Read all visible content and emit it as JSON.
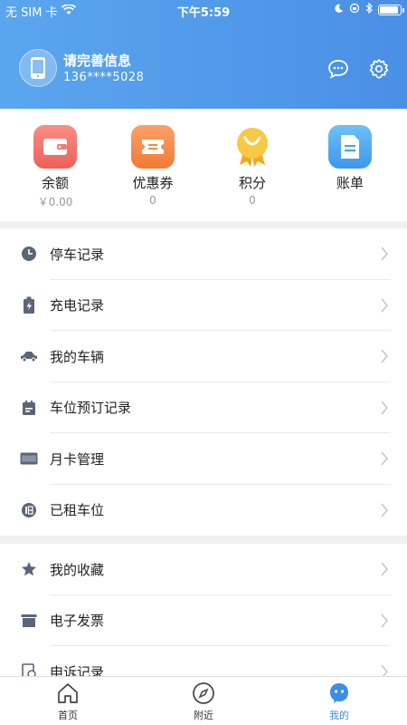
{
  "status_bar": {
    "carrier": "无 SIM 卡",
    "time": "下午5:59"
  },
  "user": {
    "name": "请完善信息",
    "phone": "136****5028"
  },
  "quick": [
    {
      "label": "余额",
      "value": "￥0.00",
      "icon": "wallet-icon",
      "color": "#f0736c"
    },
    {
      "label": "优惠券",
      "value": "0",
      "icon": "ticket-icon",
      "color": "#f58a45"
    },
    {
      "label": "积分",
      "value": "0",
      "icon": "medal-icon",
      "color": "#f6c33a"
    },
    {
      "label": "账单",
      "value": "",
      "icon": "bill-icon",
      "color": "#4aa6f0"
    }
  ],
  "menu_group1": [
    {
      "label": "停车记录",
      "icon": "clock-icon"
    },
    {
      "label": "充电记录",
      "icon": "battery-icon"
    },
    {
      "label": "我的车辆",
      "icon": "car-icon"
    },
    {
      "label": "车位预订记录",
      "icon": "calendar-icon"
    },
    {
      "label": "月卡管理",
      "icon": "card-icon"
    },
    {
      "label": "已租车位",
      "icon": "rent-icon"
    }
  ],
  "menu_group2": [
    {
      "label": "我的收藏",
      "icon": "star-icon"
    },
    {
      "label": "电子发票",
      "icon": "invoice-icon"
    },
    {
      "label": "申诉记录",
      "icon": "appeal-icon"
    }
  ],
  "tabs": [
    {
      "label": "首页",
      "icon": "home-icon",
      "active": false
    },
    {
      "label": "附近",
      "icon": "compass-icon",
      "active": false
    },
    {
      "label": "我的",
      "icon": "profile-icon",
      "active": true
    }
  ],
  "colors": {
    "accent": "#3a8ee8",
    "icon_gray": "#5b6577"
  }
}
